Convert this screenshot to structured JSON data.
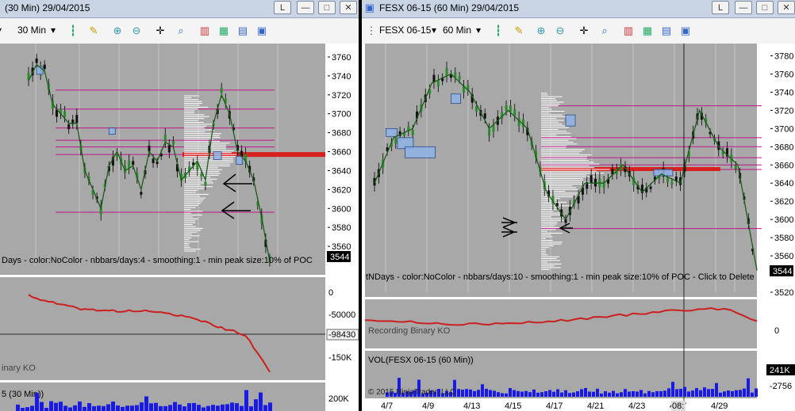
{
  "left": {
    "title": "(30 Min)  29/04/2015",
    "interval": "30 Min",
    "price_ticks": [
      "3760",
      "3740",
      "3720",
      "3700",
      "3680",
      "3660",
      "3640",
      "3620",
      "3600",
      "3580",
      "3560"
    ],
    "last_price": "3544",
    "indicator_label": "Days  - color:NoColor - nbbars/days:4 - smoothing:1 - min peak size:10% of POC",
    "ko_ticks": [
      "0",
      "-50000",
      "-150K"
    ],
    "ko_value": "-98430",
    "ko_label": "inary KO",
    "vol_label": "5 (30 Min))",
    "vol_tick": "200K"
  },
  "right": {
    "title": "FESX 06-15 (60 Min)  29/04/2015",
    "instrument": "FESX 06-15",
    "interval": "60 Min",
    "price_ticks": [
      "3780",
      "3760",
      "3740",
      "3720",
      "3700",
      "3680",
      "3660",
      "3640",
      "3620",
      "3600",
      "3580",
      "3560",
      "3520"
    ],
    "last_price": "3544",
    "indicator_label": "tNDays  - color:NoColor - nbbars/days:10 - smoothing:1 - min peak size:10% of POC - Click to Delete",
    "ko_label": "Recording Binary KO",
    "ko_tick": "0",
    "vol_label": "VOL(FESX 06-15 (60 Min))",
    "vol_value": "241K",
    "vol_neg": "-2756",
    "copyright": "© 2015 NinjaTrader, LLC",
    "dates": [
      "4/7",
      "4/9",
      "4/13",
      "4/15",
      "4/17",
      "4/21",
      "4/23",
      "4/27",
      "4/29"
    ],
    "cursor_label": "08:"
  },
  "buttons": {
    "l_label": "L",
    "min_label": "—",
    "max_label": "□",
    "close_label": "✕"
  },
  "chart_data": [
    {
      "type": "line",
      "title": "(30 Min)  29/04/2015",
      "x": [
        0,
        6,
        12,
        18,
        24,
        30,
        36,
        42,
        48,
        54,
        60,
        66,
        72,
        78,
        84,
        90,
        96,
        102,
        108,
        114,
        120,
        126,
        132,
        138,
        144,
        150,
        156,
        162,
        168,
        174,
        180
      ],
      "series": [
        {
          "values": [
            3735,
            3752,
            3745,
            3710,
            3700,
            3690,
            3690,
            3640,
            3620,
            3600,
            3645,
            3660,
            3640,
            3645,
            3620,
            3660,
            3650,
            3670,
            3665,
            3630,
            3640,
            3650,
            3630,
            3690,
            3720,
            3700,
            3660,
            3650,
            3630,
            3590,
            3544
          ]
        }
      ],
      "ylim": [
        3540,
        3770
      ],
      "horizontal_levels": [
        3725,
        3705,
        3685,
        3672,
        3665,
        3657,
        3596
      ],
      "poc": 3657
    },
    {
      "type": "line",
      "title": "FESX 06-15 (60 Min)  29/04/2015",
      "categories": [
        "4/7",
        "4/9",
        "4/13",
        "4/15",
        "4/17",
        "4/21",
        "4/23",
        "4/27",
        "4/29"
      ],
      "x": [
        0,
        5,
        10,
        15,
        20,
        25,
        30,
        35,
        40,
        45,
        50,
        55,
        60,
        65,
        70,
        75,
        80,
        85,
        90,
        95,
        100
      ],
      "series": [
        {
          "values": [
            3640,
            3690,
            3700,
            3750,
            3760,
            3740,
            3700,
            3720,
            3700,
            3630,
            3600,
            3640,
            3640,
            3660,
            3630,
            3650,
            3640,
            3720,
            3680,
            3660,
            3544
          ]
        }
      ],
      "ylim": [
        3520,
        3790
      ],
      "horizontal_levels": [
        3725,
        3690,
        3680,
        3668,
        3660,
        3655,
        3590
      ],
      "poc": 3655
    }
  ]
}
